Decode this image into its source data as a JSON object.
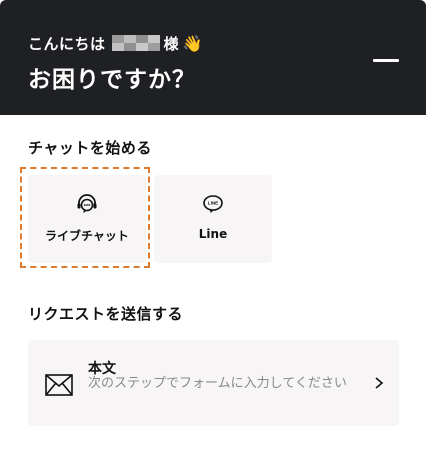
{
  "header": {
    "greeting": "こんにちは",
    "honorific": "様",
    "wave_emoji": "👋",
    "headline": "お困りですか？",
    "minimize_icon": "minus-icon"
  },
  "chat_section": {
    "title": "チャットを始める",
    "options": [
      {
        "label": "ライブチャット",
        "icon": "headset-chat-icon",
        "highlighted": true
      },
      {
        "label": "Line",
        "icon": "line-logo-icon",
        "highlighted": false
      }
    ]
  },
  "request_section": {
    "title": "リクエストを送信する",
    "card": {
      "title": "本文",
      "description": "次のステップでフォームに入力してください",
      "icon": "mail-icon",
      "chevron": "chevron-right-icon"
    }
  },
  "colors": {
    "header_bg": "#1f2024",
    "card_bg": "#f7f5f5",
    "highlight": "#dd7a2e"
  }
}
